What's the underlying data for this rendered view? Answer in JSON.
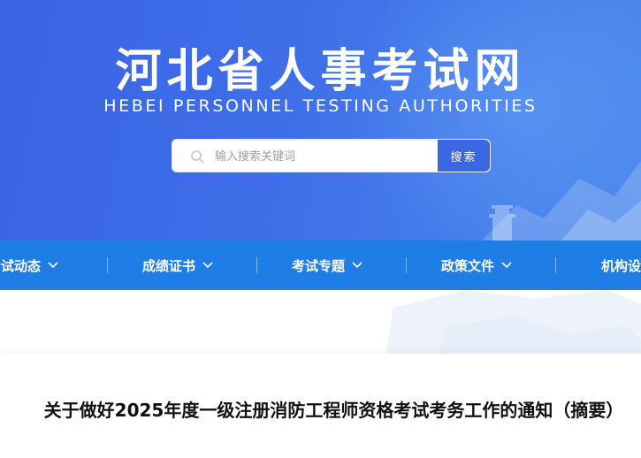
{
  "header": {
    "title": "河北省人事考试网",
    "subtitle": "HEBEI PERSONNEL TESTING AUTHORITIES"
  },
  "search": {
    "placeholder": "输入搜索关键词",
    "button_label": "搜索"
  },
  "nav": {
    "items": [
      {
        "label": "考试动态"
      },
      {
        "label": "成绩证书"
      },
      {
        "label": "考试专题"
      },
      {
        "label": "政策文件"
      },
      {
        "label": "机构设"
      }
    ]
  },
  "article": {
    "title": "关于做好2025年度一级注册消防工程师资格考试考务工作的通知（摘要）"
  },
  "colors": {
    "banner": "#3f6fe8",
    "nav": "#1f7de6",
    "search_button": "#3b67e2"
  }
}
